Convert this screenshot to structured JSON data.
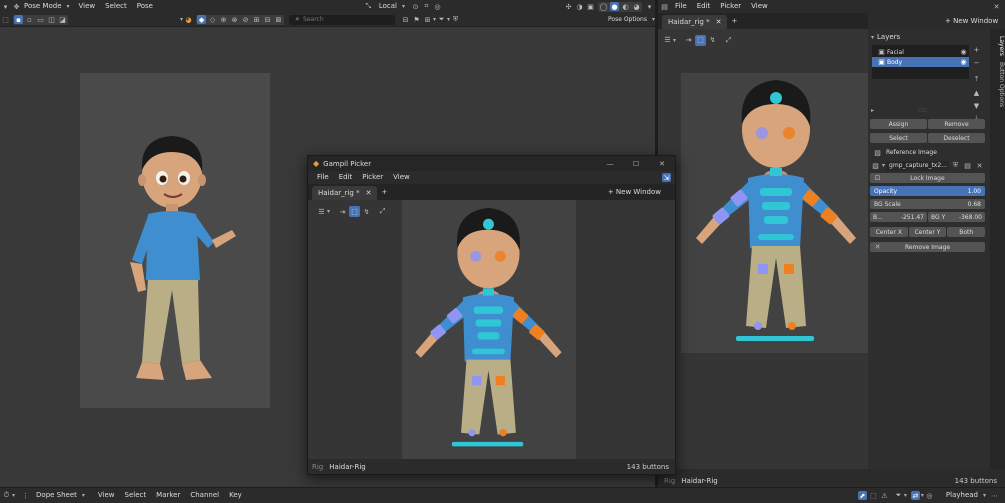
{
  "viewport": {
    "mode": "Pose Mode",
    "menus": [
      "View",
      "Select",
      "Pose"
    ],
    "transform_orientation": "Local",
    "search_placeholder": "Search",
    "pose_options": "Pose Options"
  },
  "picker_panel": {
    "menus": [
      "File",
      "Edit",
      "Picker",
      "View"
    ],
    "tab_label": "Haidar_rig *",
    "new_window": "+ New Window",
    "layers_title": "Layers",
    "layers": [
      {
        "name": "Facial",
        "selected": false
      },
      {
        "name": "Body",
        "selected": true
      }
    ],
    "assign": "Assign",
    "remove": "Remove",
    "select": "Select",
    "deselect": "Deselect",
    "reference_title": "Reference Image",
    "reference_file": "gmp_capture_tx2...",
    "lock_image": "Lock Image",
    "opacity_label": "Opacity",
    "opacity_value": "1.00",
    "bg_scale_label": "BG Scale",
    "bg_scale_value": "0.68",
    "bgx_label": "B...",
    "bgx_value": "-251.47",
    "bgy_label": "BG Y",
    "bgy_value": "-368.00",
    "center_x": "Center X",
    "center_y": "Center Y",
    "both": "Both",
    "remove_image": "Remove Image",
    "side_tabs": [
      "Layers",
      "Button Options"
    ],
    "status_rig": "Rig",
    "status_name": "Haidar-Rig",
    "status_count": "143 buttons"
  },
  "picker_window": {
    "title": "Gampil Picker",
    "menus": [
      "File",
      "Edit",
      "Picker",
      "View"
    ],
    "tab_label": "Haidar_rig *",
    "new_window": "+ New Window",
    "status_rig": "Rig",
    "status_name": "Haidar-Rig",
    "status_count": "143 buttons"
  },
  "dopesheet": {
    "editor": "Dope Sheet",
    "menus": [
      "View",
      "Select",
      "Marker",
      "Channel",
      "Key"
    ],
    "playhead": "Playhead"
  },
  "colors": {
    "accent": "#4772b3",
    "left_bone": "#8f95f2",
    "right_bone": "#ef7f1f",
    "center_bone": "#2fc6d6"
  }
}
